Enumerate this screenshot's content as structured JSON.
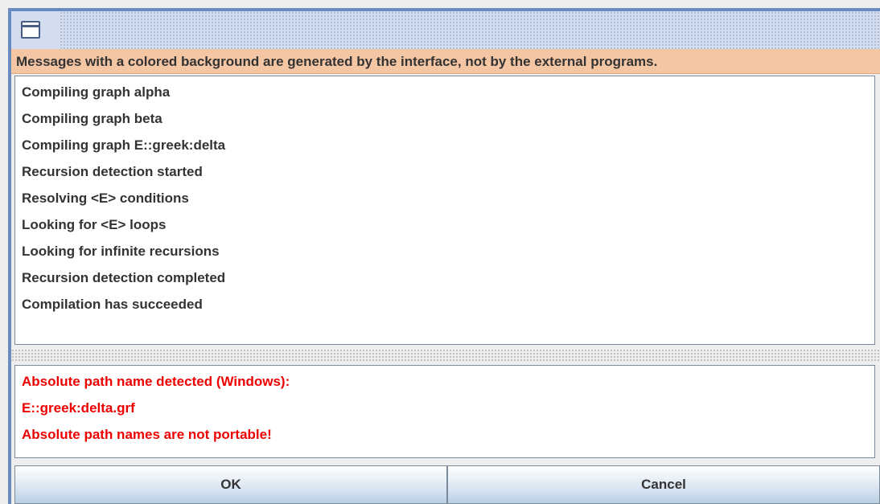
{
  "window": {
    "icon": "window-icon"
  },
  "banner": {
    "text": "Messages with a colored background are generated by the interface, not by the external programs."
  },
  "messages": [
    "Compiling graph alpha",
    "Compiling graph beta",
    "Compiling graph E::greek:delta",
    "Recursion detection started",
    "Resolving <E> conditions",
    "Looking for <E> loops",
    "Looking for infinite recursions",
    "Recursion detection completed",
    "Compilation has succeeded"
  ],
  "errors": [
    "Absolute path name detected (Windows):",
    "E::greek:delta.grf",
    "Absolute path names are not portable!"
  ],
  "buttons": {
    "ok_label": "OK",
    "cancel_label": "Cancel"
  },
  "colors": {
    "banner_bg": "#f5c6a4",
    "error_text": "#ee0000",
    "frame": "#6b8bbf"
  }
}
